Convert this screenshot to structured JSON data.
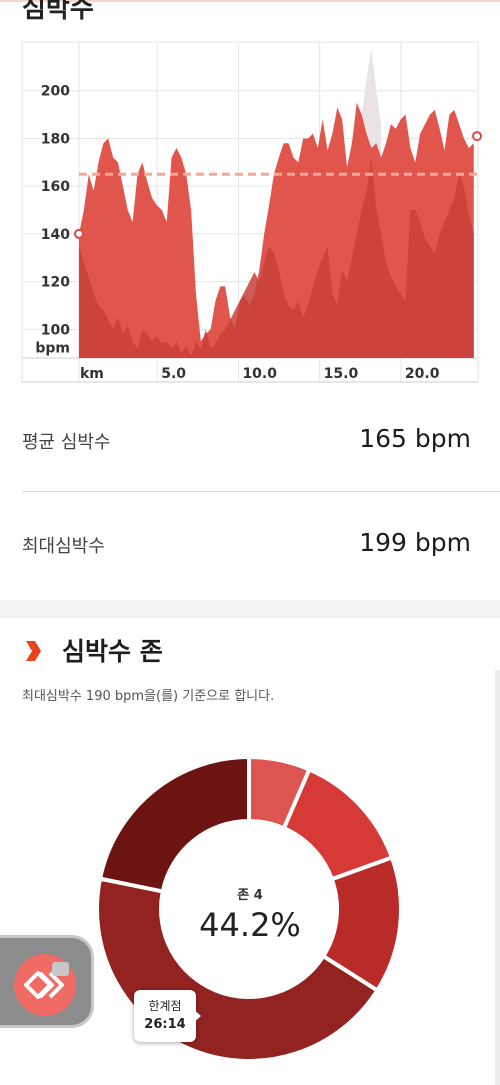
{
  "heart_rate": {
    "title": "심박수",
    "avg_label": "평균 심박수",
    "avg_value": "165 bpm",
    "max_label": "최대심박수",
    "max_value": "199 bpm"
  },
  "chart_data": {
    "type": "area",
    "ylabel": "bpm",
    "xlabel": "km",
    "y_ticks": [
      "200",
      "180",
      "160",
      "140",
      "120",
      "100"
    ],
    "x_ticks": [
      "km",
      "5.0",
      "10.0",
      "15.0",
      "20.0"
    ],
    "x_range": [
      0,
      24.5
    ],
    "y_range": [
      88,
      220
    ],
    "average": 165,
    "colors": {
      "max_area": "#e0564d",
      "avg_area": "#c8403a",
      "peak": "#e9e3e3",
      "avg_line": "#f4a898"
    },
    "x": [
      0,
      0.3,
      0.6,
      0.9,
      1.2,
      1.5,
      1.8,
      2.1,
      2.4,
      2.7,
      3.0,
      3.3,
      3.6,
      3.9,
      4.2,
      4.5,
      4.8,
      5.1,
      5.4,
      5.7,
      6.0,
      6.3,
      6.6,
      6.9,
      7.2,
      7.5,
      7.8,
      8.1,
      8.4,
      8.7,
      9.0,
      9.3,
      9.6,
      9.9,
      10.2,
      10.5,
      10.8,
      11.1,
      11.4,
      11.7,
      12.0,
      12.3,
      12.6,
      12.9,
      13.2,
      13.5,
      13.8,
      14.1,
      14.4,
      14.7,
      15.0,
      15.3,
      15.6,
      15.9,
      16.2,
      16.5,
      16.8,
      17.1,
      17.4,
      17.7,
      18.0,
      18.3,
      18.6,
      18.9,
      19.2,
      19.5,
      19.8,
      20.1,
      20.4,
      20.7,
      21.0,
      21.3,
      21.6,
      21.9,
      22.2,
      22.5,
      22.8,
      23.1,
      23.4,
      23.7,
      24.0,
      24.3
    ],
    "max": [
      140,
      150,
      165,
      158,
      170,
      178,
      180,
      172,
      170,
      160,
      150,
      145,
      165,
      170,
      162,
      155,
      152,
      150,
      145,
      172,
      176,
      172,
      165,
      150,
      115,
      95,
      98,
      100,
      112,
      118,
      118,
      105,
      100,
      112,
      114,
      110,
      115,
      125,
      140,
      152,
      165,
      172,
      178,
      178,
      172,
      170,
      180,
      180,
      182,
      176,
      188,
      175,
      182,
      193,
      188,
      168,
      178,
      195,
      190,
      182,
      176,
      178,
      172,
      178,
      186,
      184,
      188,
      190,
      176,
      170,
      182,
      186,
      190,
      192,
      184,
      175,
      190,
      192,
      186,
      180,
      176,
      178
    ],
    "avg": [
      135,
      128,
      122,
      115,
      110,
      108,
      104,
      100,
      105,
      98,
      102,
      95,
      92,
      100,
      98,
      95,
      97,
      94,
      95,
      92,
      95,
      90,
      93,
      89,
      95,
      92,
      100,
      92,
      94,
      98,
      100,
      104,
      108,
      112,
      116,
      120,
      124,
      120,
      128,
      135,
      132,
      125,
      115,
      110,
      108,
      112,
      105,
      110,
      118,
      125,
      130,
      135,
      115,
      110,
      125,
      120,
      130,
      140,
      150,
      158,
      172,
      150,
      140,
      128,
      122,
      118,
      115,
      112,
      150,
      150,
      145,
      138,
      135,
      132,
      140,
      145,
      150,
      155,
      165,
      160,
      148,
      140
    ],
    "peak": [
      [
        17.4,
        190
      ],
      [
        17.7,
        205
      ],
      [
        18.0,
        218
      ],
      [
        18.3,
        200
      ],
      [
        18.6,
        185
      ]
    ]
  },
  "zones": {
    "title": "심박수 존",
    "subtitle": "최대심박수 190 bpm을(를) 기준으로 합니다.",
    "center_label": "존 4",
    "center_value": "44.2%",
    "tooltip_label": "한계점",
    "tooltip_value": "26:14",
    "segments": [
      {
        "percent": 6.5,
        "color": "#dd5550"
      },
      {
        "percent": 13.0,
        "color": "#d63a36"
      },
      {
        "percent": 14.5,
        "color": "#b92b28"
      },
      {
        "percent": 44.2,
        "color": "#922321"
      },
      {
        "percent": 21.8,
        "color": "#6b1412"
      }
    ]
  }
}
